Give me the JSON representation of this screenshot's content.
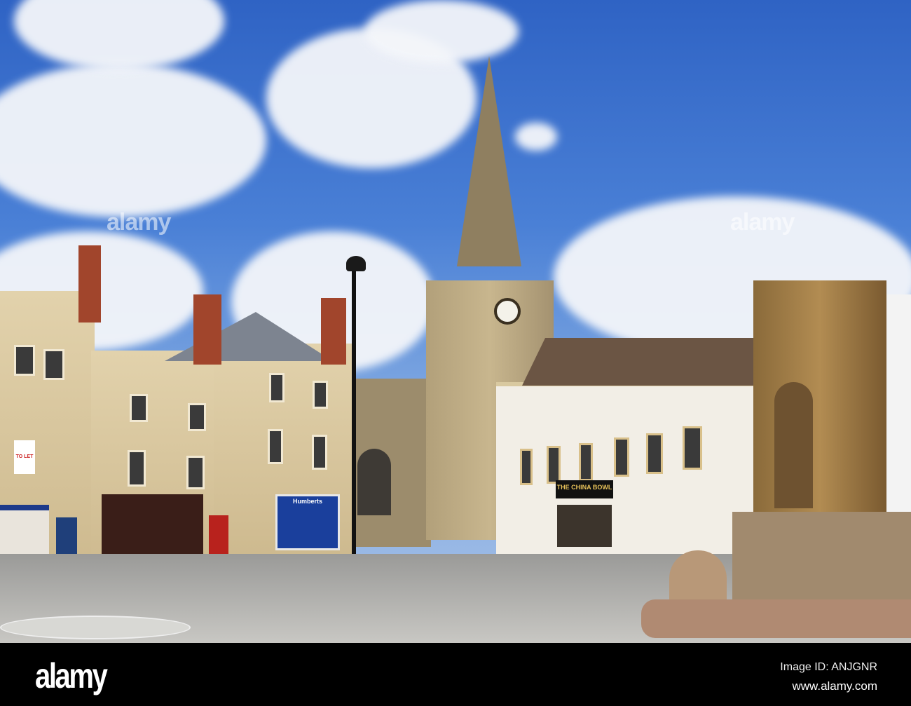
{
  "photo": {
    "subject": "Town square with church spire",
    "signs": {
      "china_bowl": "THE CHINA BOWL",
      "humberts": "Humberts",
      "to_let": "TO LET"
    },
    "watermark": "alamy"
  },
  "footer": {
    "logo": "alamy",
    "image_id": "Image ID: ANJGNR",
    "website": "www.alamy.com"
  },
  "colors": {
    "sky": "#4a80d6",
    "stone": "#d6c49a",
    "footer": "#000000"
  }
}
